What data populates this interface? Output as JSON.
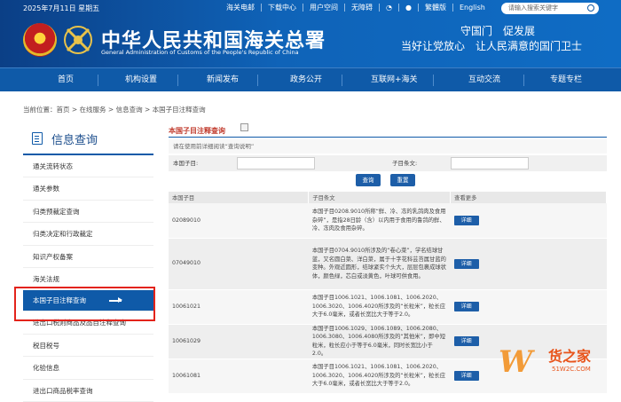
{
  "header": {
    "date": "2025年7月11日 星期五",
    "links": [
      "海关电邮",
      "下载中心",
      "用户空间",
      "无障碍",
      "繁體版",
      "English"
    ],
    "search_placeholder": "请输入搜索关键字",
    "site_title": "中华人民共和国海关总署",
    "site_subtitle": "General Administration of Customs of the People's Republic of China",
    "slogan_line1": "守国门　促发展",
    "slogan_line2": "当好让党放心　让人民满意的国门卫士"
  },
  "nav": {
    "items": [
      "首页",
      "机构设置",
      "新闻发布",
      "政务公开",
      "互联网+海关",
      "互动交流",
      "专题专栏"
    ]
  },
  "breadcrumb": "当前位置：首页 > 在线服务 > 信息查询 > 本国子目注释查询",
  "sidebar": {
    "title": "信息查询",
    "items": [
      "通关流转状态",
      "通关参数",
      "归类预裁定查询",
      "归类决定和行政裁定",
      "知识产权备案",
      "海关法规",
      "本国子目注释查询",
      "进出口税则商品及品目注释查询",
      "税目税号",
      "化验信息",
      "进出口商品税率查询"
    ],
    "active_index": 6
  },
  "main": {
    "title": "本国子目注释查询",
    "note": "请在使用前详细阅读“查询说明”",
    "field1_label": "本国子目:",
    "field2_label": "子目条文:",
    "query_button": "查询",
    "reset_button": "重置",
    "columns": [
      "本国子目",
      "子目条文",
      "查看更多"
    ],
    "detail_label": "详细",
    "rows": [
      {
        "code": "02089010",
        "text": "本国子目0208.9010所称“鲜、冷、冻的乳鸽肉及食用杂碎”，是指28日龄（含）以内用于食用的鲁鸽的鲜、冷、冻肉及食用杂碎。"
      },
      {
        "code": "07049010",
        "text": "本国子目0704.9010所涉及的“卷心菜”，学名结球甘蓝，又名圆白菜、洋白菜，属于十字花科芸苔属甘蓝的变种。外观近圆形，结球紧实个头大，层层包裹成球状体，颜色绿，芯白或淡黄色，叶球可供食用。"
      },
      {
        "code": "10061021",
        "text": "本国子目1006.1021、1006.1081、1006.2020、1006.3020、1006.4020所涉及的“长粒米”，粒长应大于6.0毫米，或者长宽比大于等于2.0。"
      },
      {
        "code": "10061029",
        "text": "本国子目1006.1029、1006.1089、1006.2080、1006.3080、1006.4080所涉及的“其他米”，即中短粒米，粒长应小于等于6.0毫米，同时长宽比小于2.0。"
      },
      {
        "code": "10061081",
        "text": "本国子目1006.1021、1006.1081、1006.2020、1006.3020、1006.4020所涉及的“长粒米”，粒长应大于6.0毫米，或者长宽比大于等于2.0。"
      }
    ]
  },
  "watermark": {
    "letter": "W",
    "name": "货之家",
    "url": "51W2C.COM"
  }
}
